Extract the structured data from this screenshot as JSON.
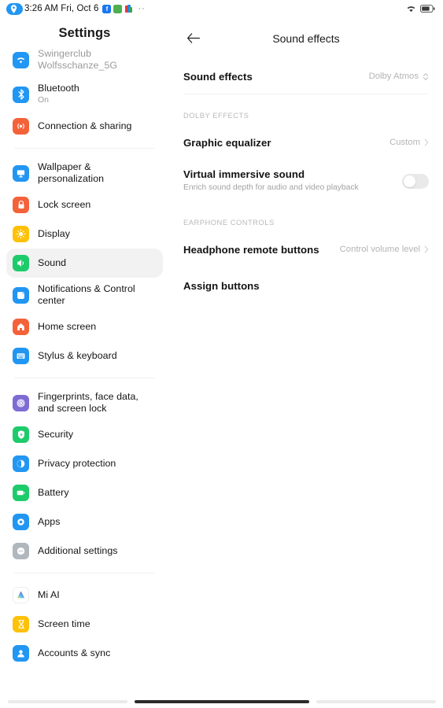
{
  "status_bar": {
    "location_icon": "location-pin-icon",
    "time": "3:26 AM Fri, Oct 6",
    "app_icons": [
      "facebook-icon",
      "green-app-icon",
      "multicolor-app-icon"
    ],
    "overflow": "··",
    "wifi_icon": "wifi-icon",
    "battery_icon": "battery-icon"
  },
  "sidebar": {
    "title": "Settings",
    "groups": [
      {
        "items": [
          {
            "label": "Swingerclub Wolfsschanze_5G",
            "sub": "",
            "icon": "wifi-icon",
            "color": "#2196f3",
            "muted": true,
            "clipped": true,
            "selected": false
          },
          {
            "label": "Bluetooth",
            "sub": "On",
            "icon": "bluetooth-icon",
            "color": "#2196f3",
            "muted": false,
            "clipped": false,
            "selected": false
          },
          {
            "label": "Connection & sharing",
            "sub": "",
            "icon": "connection-sharing-icon",
            "color": "#f4623a",
            "muted": false,
            "clipped": false,
            "selected": false
          }
        ]
      },
      {
        "items": [
          {
            "label": "Wallpaper & personalization",
            "sub": "",
            "icon": "wallpaper-icon",
            "color": "#2196f3",
            "muted": false,
            "clipped": false,
            "selected": false
          },
          {
            "label": "Lock screen",
            "sub": "",
            "icon": "lock-screen-icon",
            "color": "#f4623a",
            "muted": false,
            "clipped": false,
            "selected": false
          },
          {
            "label": "Display",
            "sub": "",
            "icon": "display-brightness-icon",
            "color": "#ffc107",
            "muted": false,
            "clipped": false,
            "selected": false
          },
          {
            "label": "Sound",
            "sub": "",
            "icon": "speaker-icon",
            "color": "#1ecb6b",
            "muted": false,
            "clipped": false,
            "selected": true
          },
          {
            "label": "Notifications & Control center",
            "sub": "",
            "icon": "notifications-icon",
            "color": "#2196f3",
            "muted": false,
            "clipped": false,
            "selected": false
          },
          {
            "label": "Home screen",
            "sub": "",
            "icon": "home-icon",
            "color": "#f4623a",
            "muted": false,
            "clipped": false,
            "selected": false
          },
          {
            "label": "Stylus & keyboard",
            "sub": "",
            "icon": "keyboard-icon",
            "color": "#2196f3",
            "muted": false,
            "clipped": false,
            "selected": false
          }
        ]
      },
      {
        "items": [
          {
            "label": "Fingerprints, face data, and screen lock",
            "sub": "",
            "icon": "fingerprint-icon",
            "color": "#7e6bd4",
            "muted": false,
            "clipped": false,
            "selected": false
          },
          {
            "label": "Security",
            "sub": "",
            "icon": "security-shield-icon",
            "color": "#1ecb6b",
            "muted": false,
            "clipped": false,
            "selected": false
          },
          {
            "label": "Privacy protection",
            "sub": "",
            "icon": "privacy-icon",
            "color": "#2196f3",
            "muted": false,
            "clipped": false,
            "selected": false
          },
          {
            "label": "Battery",
            "sub": "",
            "icon": "battery-icon",
            "color": "#1ecb6b",
            "muted": false,
            "clipped": false,
            "selected": false
          },
          {
            "label": "Apps",
            "sub": "",
            "icon": "apps-icon",
            "color": "#2196f3",
            "muted": false,
            "clipped": false,
            "selected": false
          },
          {
            "label": "Additional settings",
            "sub": "",
            "icon": "additional-settings-icon",
            "color": "#b0b7bd",
            "muted": false,
            "clipped": false,
            "selected": false
          }
        ]
      },
      {
        "items": [
          {
            "label": "Mi AI",
            "sub": "",
            "icon": "mi-ai-icon",
            "color": "#ffffff",
            "muted": false,
            "clipped": false,
            "selected": false
          },
          {
            "label": "Screen time",
            "sub": "",
            "icon": "screen-time-icon",
            "color": "#ffc107",
            "muted": false,
            "clipped": false,
            "selected": false
          },
          {
            "label": "Accounts & sync",
            "sub": "",
            "icon": "accounts-sync-icon",
            "color": "#2196f3",
            "muted": false,
            "clipped": true,
            "selected": false
          }
        ]
      }
    ]
  },
  "main": {
    "back_icon": "back-arrow-icon",
    "title": "Sound effects",
    "sound_effects_row": {
      "label": "Sound effects",
      "value": "Dolby Atmos",
      "icon": "selector-updown-icon"
    },
    "dolby_section": {
      "header": "DOLBY EFFECTS",
      "equalizer": {
        "label": "Graphic equalizer",
        "value": "Custom",
        "icon": "chevron-right-icon"
      },
      "immersive": {
        "label": "Virtual immersive sound",
        "sub": "Enrich sound depth for audio and video playback",
        "toggle_on": false
      }
    },
    "earphone_section": {
      "header": "EARPHONE CONTROLS",
      "remote_buttons": {
        "label": "Headphone remote buttons",
        "value": "Control volume level",
        "icon": "chevron-right-icon"
      },
      "assign_buttons": {
        "label": "Assign buttons"
      }
    }
  },
  "home_bar": {
    "name": "gesture-home-bar"
  }
}
